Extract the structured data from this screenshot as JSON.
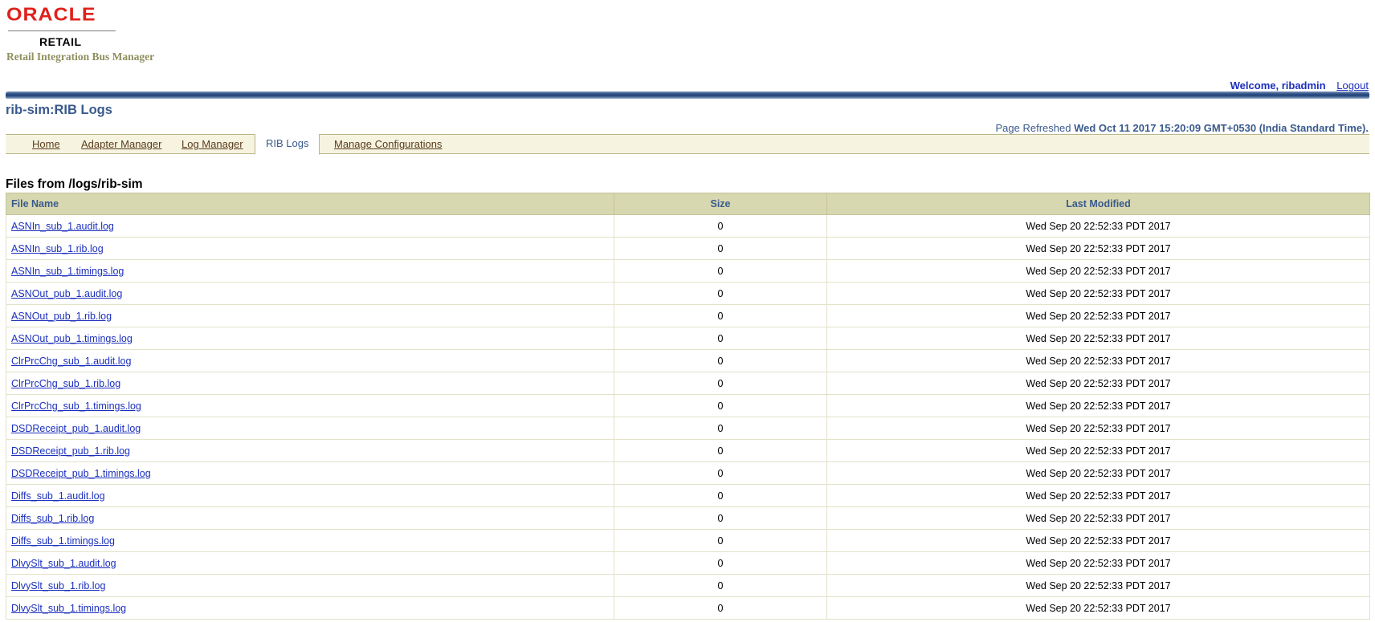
{
  "brand": {
    "logo": "ORACLE",
    "product_line": "RETAIL",
    "app_name": "Retail Integration Bus Manager"
  },
  "user": {
    "welcome": "Welcome, ribadmin",
    "logout": "Logout"
  },
  "page": {
    "title": "rib-sim:RIB Logs",
    "refreshed_label": "Page Refreshed",
    "refreshed_value": "Wed Oct 11 2017 15:20:09 GMT+0530 (India Standard Time)."
  },
  "tabs": [
    {
      "label": "Home",
      "active": false
    },
    {
      "label": "Adapter Manager",
      "active": false
    },
    {
      "label": "Log Manager",
      "active": false
    },
    {
      "label": "RIB Logs",
      "active": true
    },
    {
      "label": "Manage Configurations",
      "active": false
    }
  ],
  "files": {
    "title": "Files from /logs/rib-sim",
    "columns": [
      "File Name",
      "Size",
      "Last Modified"
    ],
    "rows": [
      {
        "name": "ASNIn_sub_1.audit.log",
        "size": "0",
        "modified": "Wed Sep 20 22:52:33 PDT 2017"
      },
      {
        "name": "ASNIn_sub_1.rib.log",
        "size": "0",
        "modified": "Wed Sep 20 22:52:33 PDT 2017"
      },
      {
        "name": "ASNIn_sub_1.timings.log",
        "size": "0",
        "modified": "Wed Sep 20 22:52:33 PDT 2017"
      },
      {
        "name": "ASNOut_pub_1.audit.log",
        "size": "0",
        "modified": "Wed Sep 20 22:52:33 PDT 2017"
      },
      {
        "name": "ASNOut_pub_1.rib.log",
        "size": "0",
        "modified": "Wed Sep 20 22:52:33 PDT 2017"
      },
      {
        "name": "ASNOut_pub_1.timings.log",
        "size": "0",
        "modified": "Wed Sep 20 22:52:33 PDT 2017"
      },
      {
        "name": "ClrPrcChg_sub_1.audit.log",
        "size": "0",
        "modified": "Wed Sep 20 22:52:33 PDT 2017"
      },
      {
        "name": "ClrPrcChg_sub_1.rib.log",
        "size": "0",
        "modified": "Wed Sep 20 22:52:33 PDT 2017"
      },
      {
        "name": "ClrPrcChg_sub_1.timings.log",
        "size": "0",
        "modified": "Wed Sep 20 22:52:33 PDT 2017"
      },
      {
        "name": "DSDReceipt_pub_1.audit.log",
        "size": "0",
        "modified": "Wed Sep 20 22:52:33 PDT 2017"
      },
      {
        "name": "DSDReceipt_pub_1.rib.log",
        "size": "0",
        "modified": "Wed Sep 20 22:52:33 PDT 2017"
      },
      {
        "name": "DSDReceipt_pub_1.timings.log",
        "size": "0",
        "modified": "Wed Sep 20 22:52:33 PDT 2017"
      },
      {
        "name": "Diffs_sub_1.audit.log",
        "size": "0",
        "modified": "Wed Sep 20 22:52:33 PDT 2017"
      },
      {
        "name": "Diffs_sub_1.rib.log",
        "size": "0",
        "modified": "Wed Sep 20 22:52:33 PDT 2017"
      },
      {
        "name": "Diffs_sub_1.timings.log",
        "size": "0",
        "modified": "Wed Sep 20 22:52:33 PDT 2017"
      },
      {
        "name": "DlvySlt_sub_1.audit.log",
        "size": "0",
        "modified": "Wed Sep 20 22:52:33 PDT 2017"
      },
      {
        "name": "DlvySlt_sub_1.rib.log",
        "size": "0",
        "modified": "Wed Sep 20 22:52:33 PDT 2017"
      },
      {
        "name": "DlvySlt_sub_1.timings.log",
        "size": "0",
        "modified": "Wed Sep 20 22:52:33 PDT 2017"
      }
    ]
  },
  "colors": {
    "oracle_red": "#e0201b",
    "link_blue": "#1b2fbd",
    "title_blue": "#3a5a8c",
    "table_header_bg": "#d8d8b0",
    "tab_bar_bg": "#f6f4e0"
  }
}
